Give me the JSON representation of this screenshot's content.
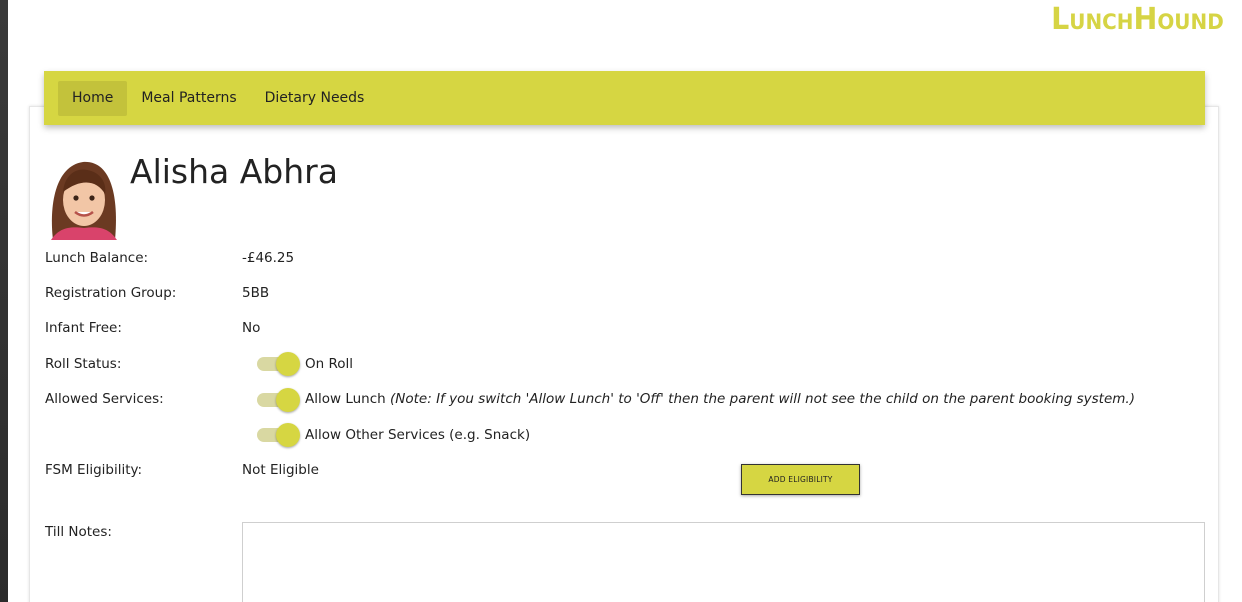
{
  "brand": {
    "logo_text": "LunchHound",
    "accent_color": "#d6d642"
  },
  "nav": {
    "items": [
      {
        "label": "Home",
        "active": true
      },
      {
        "label": "Meal Patterns",
        "active": false
      },
      {
        "label": "Dietary Needs",
        "active": false
      }
    ]
  },
  "student": {
    "name": "Alisha Abhra",
    "avatar": "student-photo"
  },
  "fields": {
    "lunch_balance": {
      "label": "Lunch Balance:",
      "value": "-£46.25"
    },
    "registration_group": {
      "label": "Registration Group:",
      "value": "5BB"
    },
    "infant_free": {
      "label": "Infant Free:",
      "value": "No"
    },
    "roll_status": {
      "label": "Roll Status:",
      "toggle_label": "On Roll",
      "on": true
    },
    "allowed_services": {
      "label": "Allowed Services:",
      "allow_lunch": {
        "label": "Allow Lunch",
        "note": "(Note: If you switch 'Allow Lunch' to 'Off' then the parent will not see the child on the parent booking system.)",
        "on": true
      },
      "allow_other": {
        "label": "Allow Other Services (e.g. Snack)",
        "on": true
      }
    },
    "fsm_eligibility": {
      "label": "FSM Eligibility:",
      "value": "Not Eligible",
      "button_label": "ADD ELIGIBILITY"
    },
    "till_notes": {
      "label": "Till Notes:",
      "value": ""
    }
  }
}
